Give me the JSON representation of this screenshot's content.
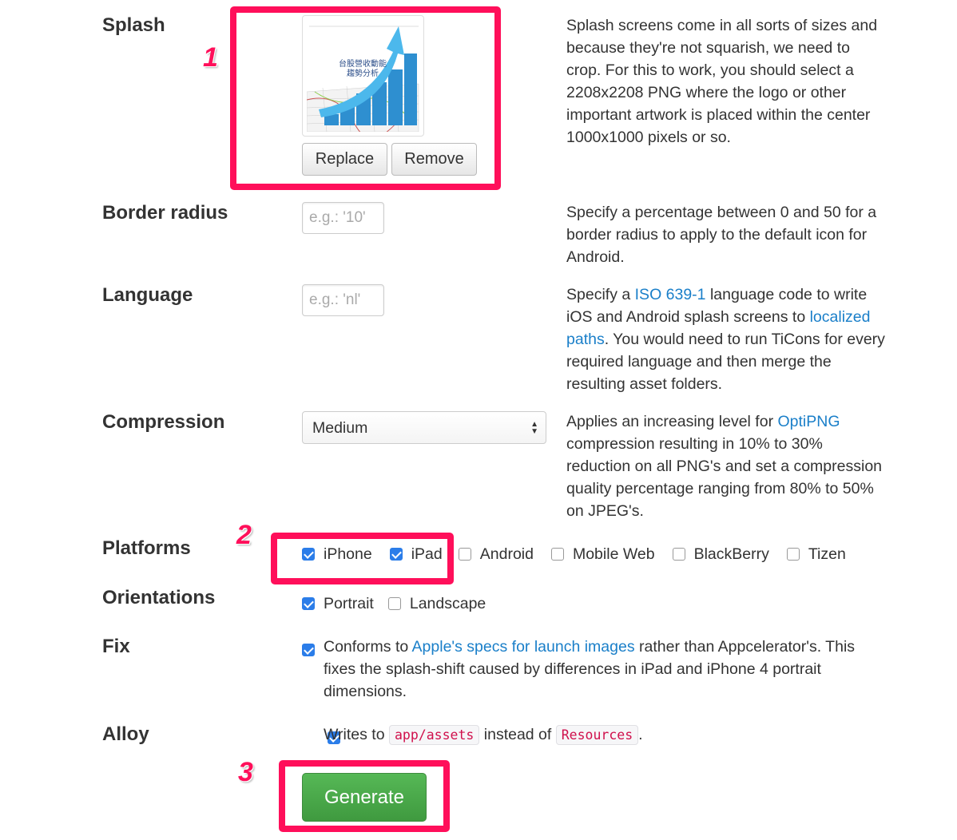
{
  "splash": {
    "label": "Splash",
    "image_text": "台股營收動能 趨勢分析",
    "replace": "Replace",
    "remove": "Remove",
    "description": "Splash screens come in all sorts of sizes and because they're not squarish, we need to crop. For this to work, you should select a 2208x2208 PNG where the logo or other important artwork is placed within the center 1000x1000 pixels or so."
  },
  "border_radius": {
    "label": "Border radius",
    "placeholder": "e.g.: '10'",
    "value": "",
    "description": "Specify a percentage between 0 and 50 for a border radius to apply to the default icon for Android."
  },
  "language": {
    "label": "Language",
    "placeholder": "e.g.: 'nl'",
    "value": "",
    "desc_1": "Specify a ",
    "link_1": "ISO 639-1",
    "desc_2": " language code to write iOS and Android splash screens to ",
    "link_2": "localized paths",
    "desc_3": ". You would need to run TiCons for every required language and then merge the resulting asset folders."
  },
  "compression": {
    "label": "Compression",
    "selected": "Medium",
    "desc_1": "Applies an increasing level for ",
    "link": "OptiPNG",
    "desc_2": " compression resulting in 10% to 30% reduction on all PNG's and set a compression quality percentage ranging from 80% to 50% on JPEG's."
  },
  "platforms": {
    "label": "Platforms",
    "options": [
      {
        "label": "iPhone",
        "checked": true
      },
      {
        "label": "iPad",
        "checked": true
      },
      {
        "label": "Android",
        "checked": false
      },
      {
        "label": "Mobile Web",
        "checked": false
      },
      {
        "label": "BlackBerry",
        "checked": false
      },
      {
        "label": "Tizen",
        "checked": false
      }
    ]
  },
  "orientations": {
    "label": "Orientations",
    "options": [
      {
        "label": "Portrait",
        "checked": true
      },
      {
        "label": "Landscape",
        "checked": false
      }
    ]
  },
  "fix": {
    "label": "Fix",
    "checked": true,
    "desc_1": "Conforms to ",
    "link": "Apple's specs for launch images",
    "desc_2": " rather than Appcelerator's. This fixes the splash-shift caused by differences in iPad and iPhone 4 portrait dimensions."
  },
  "alloy": {
    "label": "Alloy",
    "checked": true,
    "desc_1": "Writes to ",
    "code_1": "app/assets",
    "desc_2": " instead of ",
    "code_2": "Resources",
    "desc_3": "."
  },
  "generate": "Generate",
  "annotations": [
    "1",
    "2",
    "3"
  ],
  "colors": {
    "highlight": "#ff0f5a",
    "link": "#1a7fc9",
    "checkbox": "#2b7de9",
    "generate": "#4cae4c"
  }
}
